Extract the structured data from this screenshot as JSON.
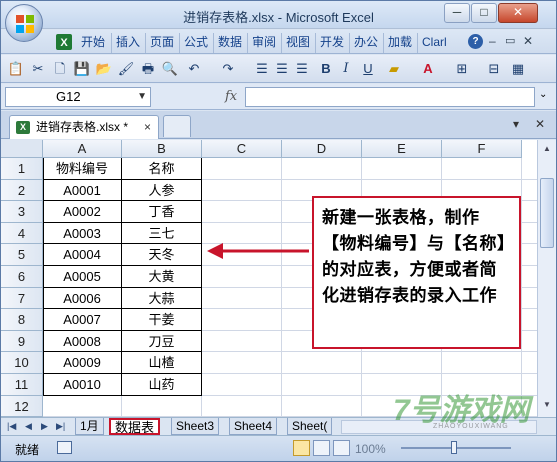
{
  "window": {
    "title": "进销存表格.xlsx - Microsoft Excel",
    "controls": [
      "─",
      "□",
      "✕"
    ]
  },
  "ribbon_tabs": [
    "开始",
    "插入",
    "页面",
    "公式",
    "数据",
    "审阅",
    "视图",
    "开发",
    "办公",
    "加载",
    "Clarl"
  ],
  "toolbar_icons": [
    "paste-icon",
    "cut-icon",
    "new-icon",
    "save-icon",
    "open-icon",
    "format-painter-icon",
    "print-icon",
    "print-preview-icon",
    "undo-icon",
    "redo-icon",
    "align-left-icon",
    "align-center-icon",
    "align-right-icon",
    "bold-icon",
    "italic-icon",
    "underline-icon",
    "fill-color-icon",
    "font-color-icon",
    "borders-icon",
    "merge-icon",
    "more-icon"
  ],
  "toolbar_labels": {
    "bold": "B",
    "italic": "I",
    "underline": "U"
  },
  "formula_bar": {
    "cell_ref": "G12",
    "fx": "fx",
    "formula": ""
  },
  "doc_tab": {
    "name": "进销存表格.xlsx *",
    "close": "×"
  },
  "columns": [
    "A",
    "B",
    "C",
    "D",
    "E",
    "F"
  ],
  "rows": [
    "1",
    "2",
    "3",
    "4",
    "5",
    "6",
    "7",
    "8",
    "9",
    "10",
    "11",
    "12"
  ],
  "table": {
    "headers": [
      "物料编号",
      "名称"
    ],
    "rows": [
      [
        "A0001",
        "人参"
      ],
      [
        "A0002",
        "丁香"
      ],
      [
        "A0003",
        "三七"
      ],
      [
        "A0004",
        "天冬"
      ],
      [
        "A0005",
        "大黄"
      ],
      [
        "A0006",
        "大蒜"
      ],
      [
        "A0007",
        "干姜"
      ],
      [
        "A0008",
        "刀豆"
      ],
      [
        "A0009",
        "山楂"
      ],
      [
        "A0010",
        "山药"
      ]
    ]
  },
  "callout": {
    "text": "新建一张表格，制作【物料编号】与【名称】的对应表，方便或者简化进销存表的录入工作",
    "border_color": "#c8142b"
  },
  "sheets": [
    "1月",
    "数据表",
    "Sheet3",
    "Sheet4",
    "Sheet("
  ],
  "active_sheet": "数据表",
  "status": {
    "ready": "就绪",
    "zoom": "100%"
  },
  "watermark": {
    "text": "7号游戏网",
    "sub": "ZHAOYOUXIWANG"
  }
}
